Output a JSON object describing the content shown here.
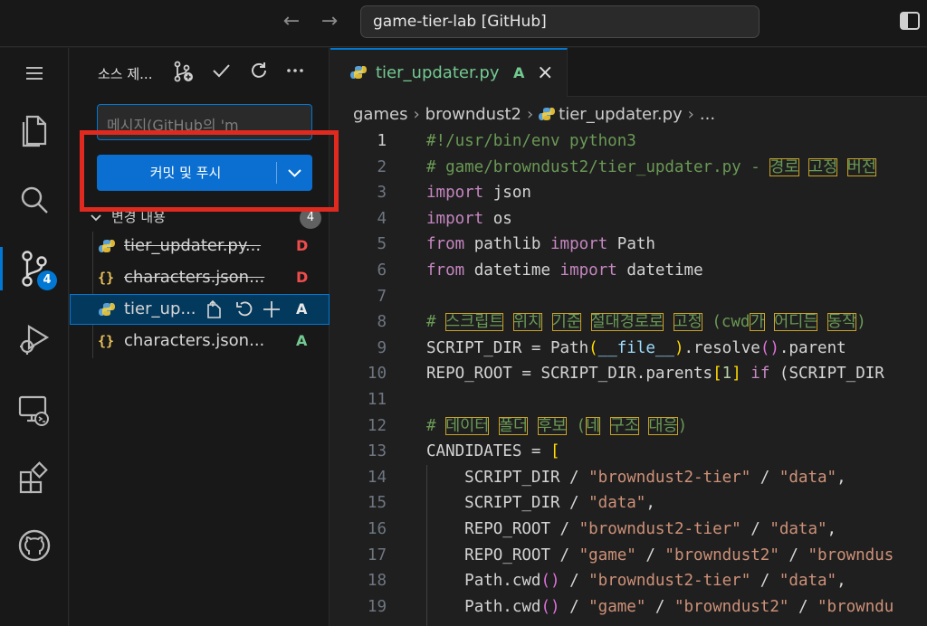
{
  "window": {
    "search_text": "game-tier-lab [GitHub]",
    "back_glyph": "←",
    "forward_glyph": "→"
  },
  "activity": {
    "scm_badge": "4",
    "icons": [
      "menu-icon",
      "explorer-files-icon",
      "search-icon",
      "source-control-icon",
      "run-debug-icon",
      "remote-explorer-icon",
      "extensions-icon",
      "github-icon"
    ]
  },
  "sidebar": {
    "title": "소스 제...",
    "message_placeholder": "메시지(GitHub의 'm",
    "commit_label": "커밋 및 푸시",
    "group_label": "변경 내용",
    "group_count": "4",
    "files": [
      {
        "name": "tier_updater.py...",
        "status": "D",
        "icon": "python-icon",
        "deleted": true
      },
      {
        "name": "characters.json...",
        "status": "D",
        "icon": "json-icon",
        "deleted": true
      },
      {
        "name": "tier_up...",
        "status": "A",
        "icon": "python-icon",
        "deleted": false
      },
      {
        "name": "characters.json...",
        "status": "A",
        "icon": "json-icon",
        "deleted": false
      }
    ]
  },
  "editor": {
    "tab_label": "tier_updater.py",
    "tab_status": "A",
    "breadcrumb": [
      "games",
      "browndust2",
      "tier_updater.py",
      "..."
    ]
  },
  "colors": {
    "accent": "#0078d4",
    "added": "#73c991",
    "deleted": "#f14c4c",
    "highlight_box": "#e02a1f"
  },
  "code": {
    "lines": [
      "1",
      "2",
      "3",
      "4",
      "5",
      "6",
      "7",
      "8",
      "9",
      "10",
      "11",
      "12",
      "13",
      "14",
      "15",
      "16",
      "17",
      "18",
      "19"
    ],
    "t": {
      "l1": "#!/usr/bin/env python3",
      "l2a": "# game/browndust2/tier_updater.py - ",
      "l2w": [
        "경로",
        "고정",
        "버전"
      ],
      "import": "import",
      "from": "from",
      "json": "json",
      "os": "os",
      "pathlib": "pathlib",
      "Path": "Path",
      "datetime": "datetime",
      "l8a": "# ",
      "l8w": [
        "스크립트",
        "위치",
        "기준",
        "절대경로로",
        "고정"
      ],
      "l8b": "(cwd",
      "l8c": "가",
      "l8d": "어디든",
      "l8e": "동작",
      "l8f": ")",
      "SCRIPT_DIR": "SCRIPT_DIR",
      "REPO_ROOT": "REPO_ROOT",
      "eq_path": " = Path",
      "file": "__file__",
      "resolve": ".resolve",
      "parent": ".parent",
      "eq": " = ",
      "parents": ".parents",
      "one": "1",
      "if": "if",
      "l10tail": "(SCRIPT_DIR",
      "l12a": "# ",
      "l12w": [
        "데이터",
        "폴더",
        "후보"
      ],
      "l12b": "(",
      "l12c": "네",
      "l12d": "구조",
      "l12e": "대응",
      "l12f": ")",
      "CANDIDATES": "CANDIDATES",
      "lbr": "[",
      "slash": " / ",
      "s_bd2tier": "\"browndust2-tier\"",
      "s_data": "\"data\"",
      "s_game": "\"game\"",
      "s_bd2": "\"browndust2\"",
      "s_brownd_cut": "\"browndus",
      "s_brownd_cut2": "\"browndu",
      "comma": ",",
      "cwd": "Path.cwd",
      "paren": "()"
    }
  }
}
